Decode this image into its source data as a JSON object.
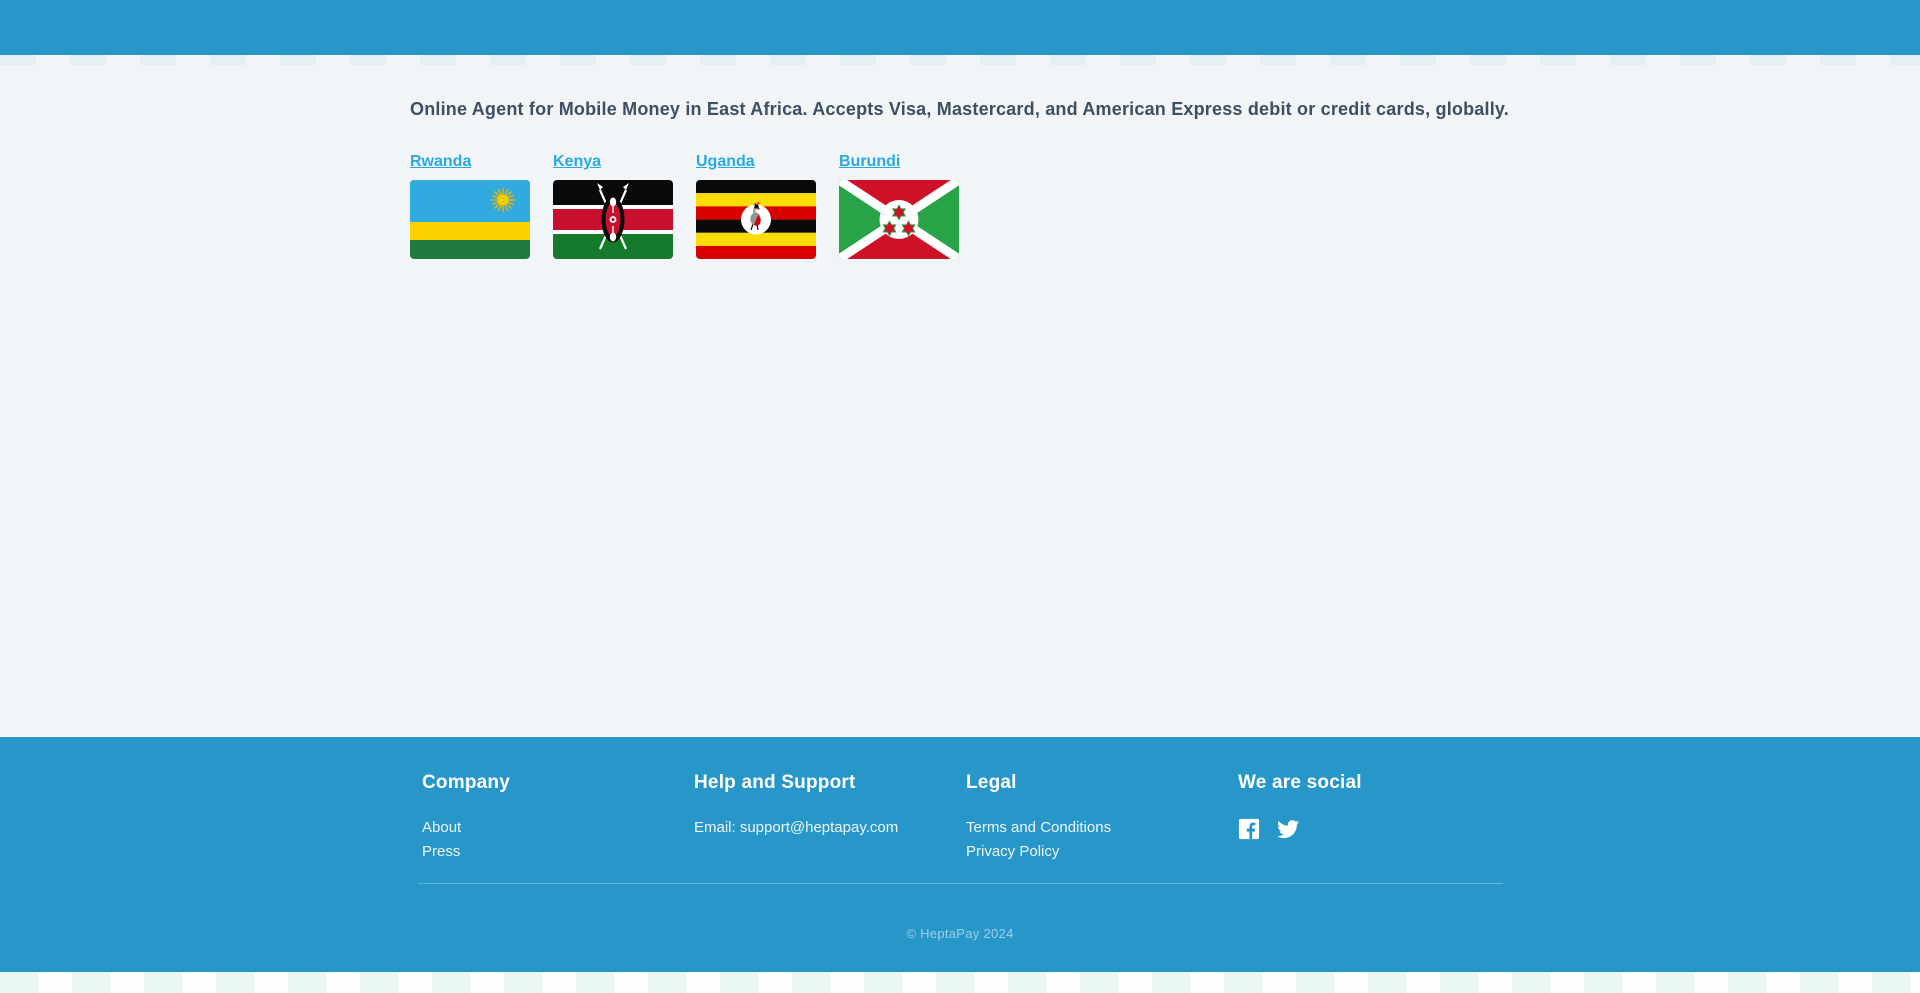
{
  "colors": {
    "brand_blue": "#2796C8",
    "link_blue": "#29A9E1",
    "heading_text": "#3E4E63",
    "page_bg": "#F1F5F7"
  },
  "main": {
    "tagline": "Online Agent for Mobile Money in East Africa. Accepts Visa, Mastercard, and American Express debit or credit cards, globally."
  },
  "countries": [
    {
      "name": "Rwanda",
      "flag_icon": "rwanda-flag-icon"
    },
    {
      "name": "Kenya",
      "flag_icon": "kenya-flag-icon"
    },
    {
      "name": "Uganda",
      "flag_icon": "uganda-flag-icon"
    },
    {
      "name": "Burundi",
      "flag_icon": "burundi-flag-icon"
    }
  ],
  "footer": {
    "columns": [
      {
        "heading": "Company",
        "links": [
          "About",
          "Press"
        ]
      },
      {
        "heading": "Help and Support",
        "links": [
          "Email: support@heptapay.com"
        ]
      },
      {
        "heading": "Legal",
        "links": [
          "Terms and Conditions",
          "Privacy Policy"
        ]
      },
      {
        "heading": "We are social",
        "icons": [
          "facebook-icon",
          "twitter-icon"
        ]
      }
    ],
    "copyright": "© HeptaPay 2024"
  }
}
